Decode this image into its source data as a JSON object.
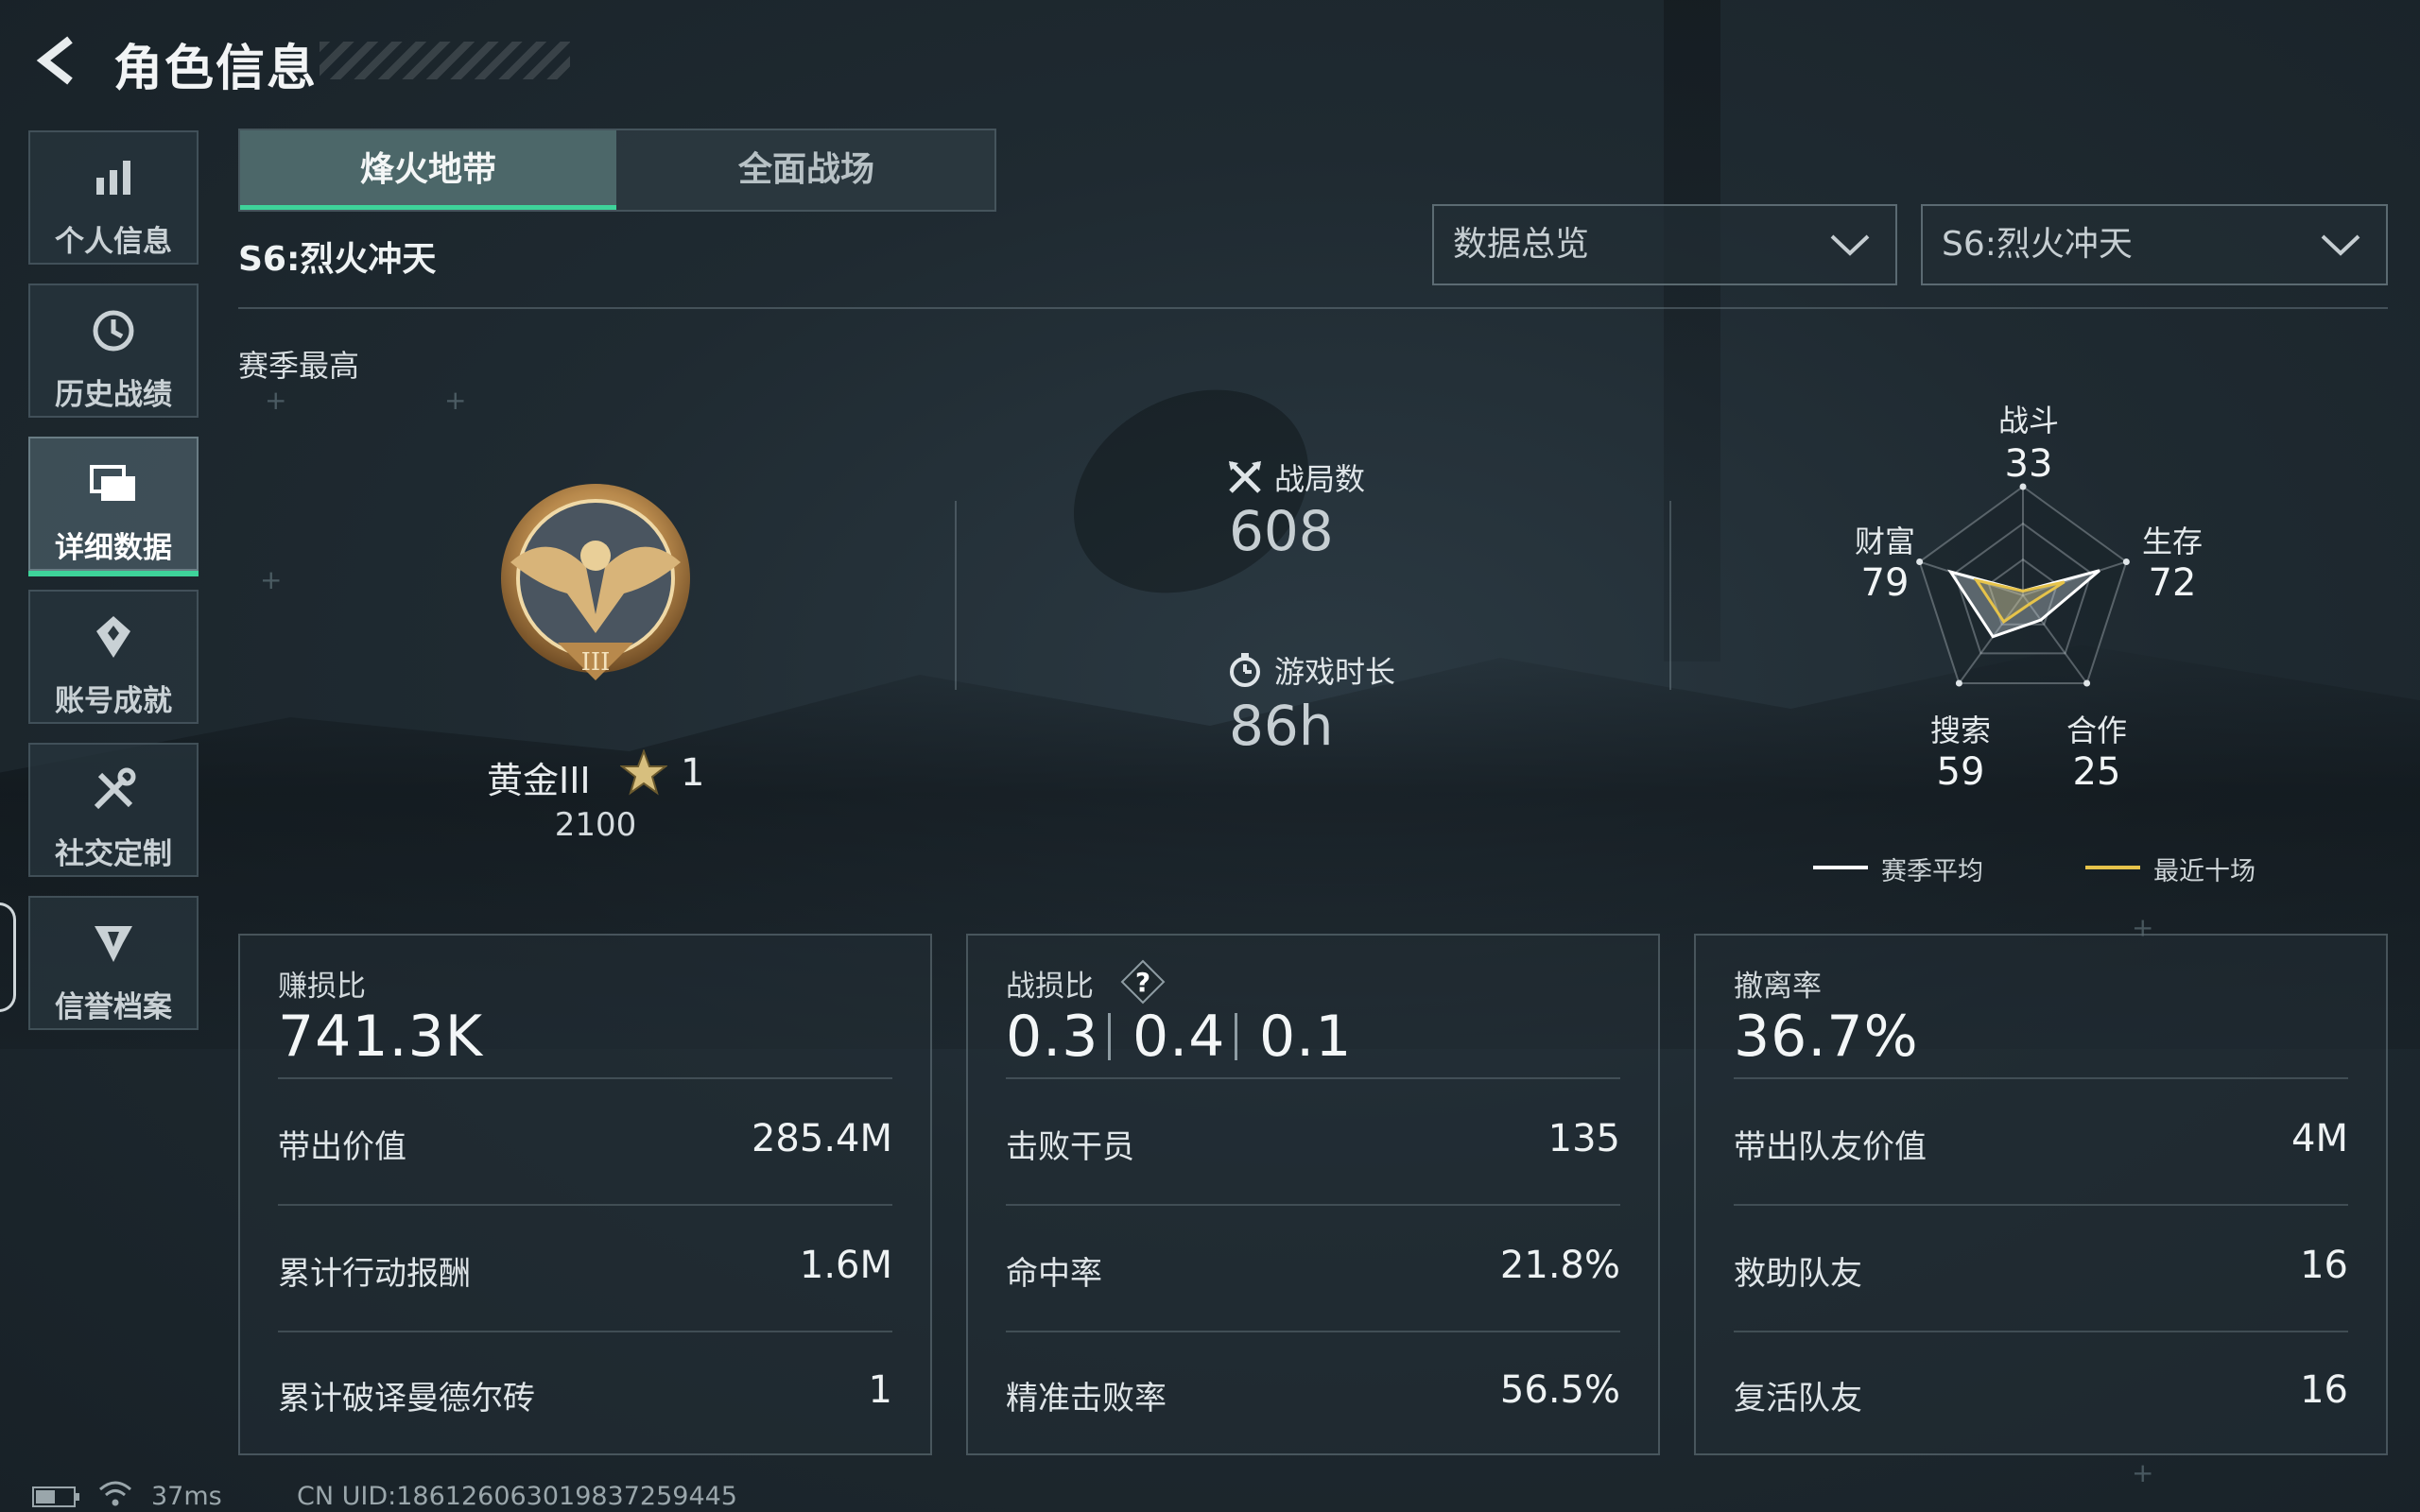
{
  "header": {
    "title": "角色信息"
  },
  "sidebar": {
    "items": [
      {
        "label": "个人信息",
        "icon": "bar-chart-icon"
      },
      {
        "label": "历史战绩",
        "icon": "history-clock-icon"
      },
      {
        "label": "详细数据",
        "icon": "folder-stack-icon",
        "active": true
      },
      {
        "label": "账号成就",
        "icon": "achievement-icon"
      },
      {
        "label": "社交定制",
        "icon": "tools-icon"
      },
      {
        "label": "信誉档案",
        "icon": "reputation-shield-icon"
      }
    ]
  },
  "tabs": [
    {
      "label": "烽火地带",
      "active": true
    },
    {
      "label": "全面战场",
      "active": false
    }
  ],
  "season_title": "S6:烈火冲天",
  "filters": {
    "view": "数据总览",
    "season": "S6:烈火冲天"
  },
  "season_best": {
    "label": "赛季最高",
    "rank_name": "黄金III",
    "rank_stars": "1",
    "rank_points": "2100"
  },
  "summary": {
    "matches_label": "战局数",
    "matches_value": "608",
    "playtime_label": "游戏时长",
    "playtime_value": "86h"
  },
  "radar": {
    "axes": [
      {
        "label": "战斗",
        "value": "33"
      },
      {
        "label": "生存",
        "value": "72"
      },
      {
        "label": "合作",
        "value": "25"
      },
      {
        "label": "搜索",
        "value": "59"
      },
      {
        "label": "财富",
        "value": "79"
      }
    ],
    "season_avg_levels": [
      0.0,
      0.74,
      0.28,
      0.47,
      0.7
    ],
    "recent10_levels": [
      0.0,
      0.4,
      0.1,
      0.3,
      0.45
    ],
    "legend": {
      "season_avg": "赛季平均",
      "recent10": "最近十场"
    },
    "colors": {
      "season_avg": "#ffffff",
      "recent10": "#e6c34a"
    }
  },
  "cards": {
    "profit": {
      "label": "赚损比",
      "main": "741.3K",
      "rows": [
        {
          "label": "带出价值",
          "value": "285.4M"
        },
        {
          "label": "累计行动报酬",
          "value": "1.6M"
        },
        {
          "label": "累计破译曼德尔砖",
          "value": "1"
        }
      ]
    },
    "kd": {
      "label": "战损比",
      "values": [
        "0.3",
        "0.4",
        "0.1"
      ],
      "rows": [
        {
          "label": "击败干员",
          "value": "135"
        },
        {
          "label": "命中率",
          "value": "21.8%"
        },
        {
          "label": "精准击败率",
          "value": "56.5%"
        }
      ]
    },
    "extract": {
      "label": "撤离率",
      "main": "36.7%",
      "rows": [
        {
          "label": "带出队友价值",
          "value": "4M"
        },
        {
          "label": "救助队友",
          "value": "16"
        },
        {
          "label": "复活队友",
          "value": "16"
        }
      ]
    }
  },
  "status_bar": {
    "ping": "37ms",
    "uid": "CN UID:186126063019837259445"
  },
  "accent_color": "#3ed39a"
}
